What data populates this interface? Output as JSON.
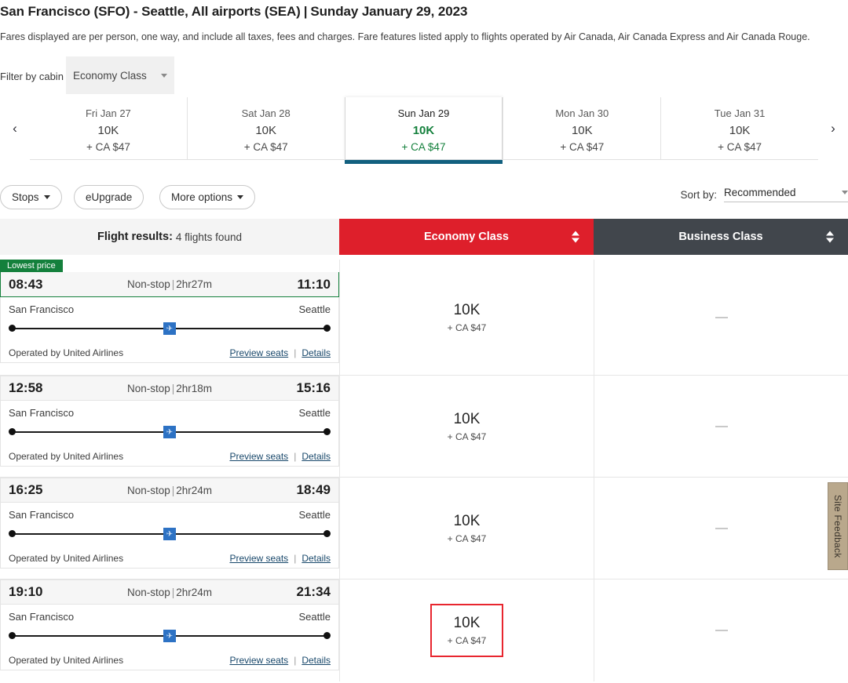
{
  "header": {
    "route": "San Francisco (SFO) - Seattle, All airports (SEA)",
    "separator": "|",
    "date": "Sunday January 29, 2023",
    "disclaimer": "Fares displayed are per person, one way, and include all taxes, fees and charges. Fare features listed apply to flights operated by Air Canada, Air Canada Express and Air Canada Rouge."
  },
  "cabin_filter": {
    "label": "Filter by cabin",
    "value": "Economy Class"
  },
  "date_strip": {
    "prev_icon": "chevron-left-icon",
    "next_icon": "chevron-right-icon",
    "dates": [
      {
        "dow": "Fri Jan 27",
        "points": "10K",
        "cash": "+ CA $47",
        "active": false
      },
      {
        "dow": "Sat Jan 28",
        "points": "10K",
        "cash": "+ CA $47",
        "active": false
      },
      {
        "dow": "Sun Jan 29",
        "points": "10K",
        "cash": "+ CA $47",
        "active": true
      },
      {
        "dow": "Mon Jan 30",
        "points": "10K",
        "cash": "+ CA $47",
        "active": false
      },
      {
        "dow": "Tue Jan 31",
        "points": "10K",
        "cash": "+ CA $47",
        "active": false
      }
    ]
  },
  "filters": {
    "stops": "Stops",
    "eupgrade": "eUpgrade",
    "more_options": "More options",
    "sort_by_label": "Sort by:",
    "sort_by_value": "Recommended"
  },
  "results_header": {
    "title": "Flight results:",
    "count": "4 flights found",
    "economy": "Economy Class",
    "business": "Business Class"
  },
  "badges": {
    "lowest_price": "Lowest price"
  },
  "common": {
    "operator": "Operated by United Airlines",
    "preview_seats": "Preview seats",
    "details": "Details",
    "pipe": "|",
    "origin": "San Francisco",
    "destination": "Seattle",
    "plane_icon": "airplane-icon",
    "empty_fare": "—"
  },
  "flights": [
    {
      "depart": "08:43",
      "arrive": "11:10",
      "stops": "Non-stop",
      "duration": "2hr27m",
      "origin": "San Francisco",
      "destination": "Seattle",
      "operator": "Operated by United Airlines",
      "lowest_price": true,
      "economy": {
        "points": "10K",
        "cash": "+ CA $47",
        "selected": false
      },
      "business": {
        "points": null,
        "cash": null,
        "available": false
      }
    },
    {
      "depart": "12:58",
      "arrive": "15:16",
      "stops": "Non-stop",
      "duration": "2hr18m",
      "origin": "San Francisco",
      "destination": "Seattle",
      "operator": "Operated by United Airlines",
      "lowest_price": false,
      "economy": {
        "points": "10K",
        "cash": "+ CA $47",
        "selected": false
      },
      "business": {
        "points": null,
        "cash": null,
        "available": false
      }
    },
    {
      "depart": "16:25",
      "arrive": "18:49",
      "stops": "Non-stop",
      "duration": "2hr24m",
      "origin": "San Francisco",
      "destination": "Seattle",
      "operator": "Operated by United Airlines",
      "lowest_price": false,
      "economy": {
        "points": "10K",
        "cash": "+ CA $47",
        "selected": false
      },
      "business": {
        "points": null,
        "cash": null,
        "available": false
      }
    },
    {
      "depart": "19:10",
      "arrive": "21:34",
      "stops": "Non-stop",
      "duration": "2hr24m",
      "origin": "San Francisco",
      "destination": "Seattle",
      "operator": "Operated by United Airlines",
      "lowest_price": false,
      "economy": {
        "points": "10K",
        "cash": "+ CA $47",
        "selected": true
      },
      "business": {
        "points": null,
        "cash": null,
        "available": false
      }
    }
  ],
  "site_feedback": {
    "label": "Site Feedback"
  },
  "colors": {
    "economy_header": "#de1f2b",
    "business_header": "#41464c",
    "lowest_price_green": "#14803c",
    "active_date_underline": "#12607f",
    "selection_red": "#e8262f",
    "link_blue": "#19486b",
    "feedback_tan": "#b9a88c"
  }
}
